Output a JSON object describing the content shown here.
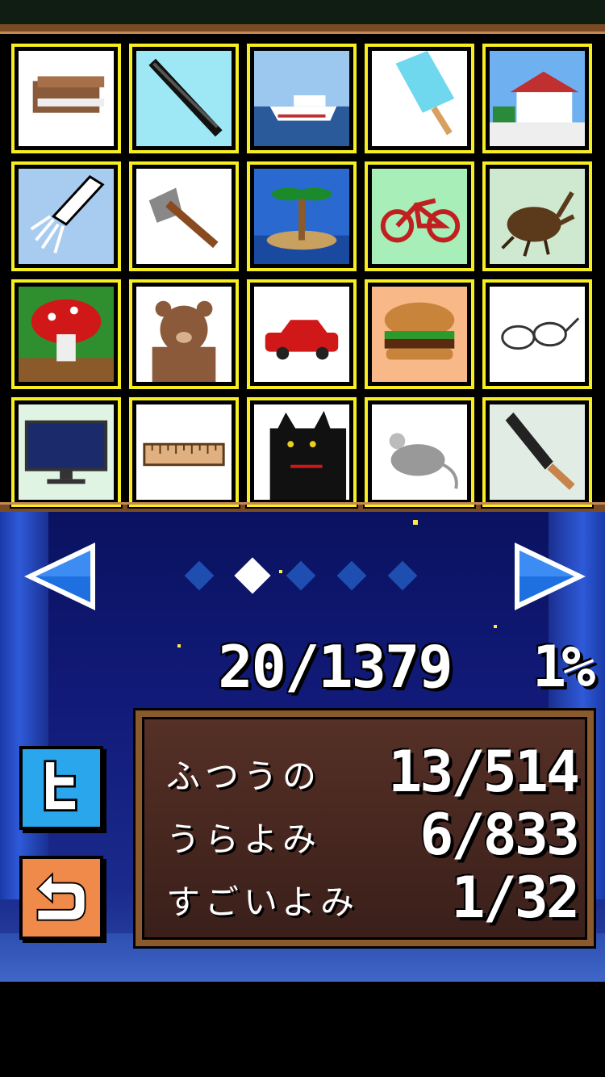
{
  "collection_grid": {
    "items": [
      {
        "name": "book-icon",
        "bg": "#ffffff"
      },
      {
        "name": "flute-icon",
        "bg": "#9ee8f5"
      },
      {
        "name": "ship-icon",
        "bg": "#9cc8f0"
      },
      {
        "name": "popsicle-icon",
        "bg": "#ffffff"
      },
      {
        "name": "house-icon",
        "bg": "#6fb0f0"
      },
      {
        "name": "squid-icon",
        "bg": "#a8ccf0"
      },
      {
        "name": "axe-icon",
        "bg": "#ffffff"
      },
      {
        "name": "island-icon",
        "bg": "#2a6ad0"
      },
      {
        "name": "bicycle-icon",
        "bg": "#a8eeb8"
      },
      {
        "name": "beetle-icon",
        "bg": "#cfe9d0"
      },
      {
        "name": "mushroom-cloud-icon",
        "bg": "#2f8f2f"
      },
      {
        "name": "bear-icon",
        "bg": "#ffffff"
      },
      {
        "name": "car-icon",
        "bg": "#ffffff"
      },
      {
        "name": "hamburger-icon",
        "bg": "#f8b888"
      },
      {
        "name": "glasses-icon",
        "bg": "#ffffff"
      },
      {
        "name": "monitor-icon",
        "bg": "#e0f4e4"
      },
      {
        "name": "ruler-icon",
        "bg": "#ffffff"
      },
      {
        "name": "black-cat-icon",
        "bg": "#ffffff"
      },
      {
        "name": "rat-icon",
        "bg": "#ffffff"
      },
      {
        "name": "knife-icon",
        "bg": "#e0ece4"
      }
    ]
  },
  "pager": {
    "page_count": 5,
    "current_page": 2
  },
  "progress": {
    "total": "20/1379",
    "percent": "1%"
  },
  "stats": {
    "rows": [
      {
        "label": "ふつうの",
        "value": "13/514"
      },
      {
        "label": "うらよみ",
        "value": "6/833"
      },
      {
        "label": "すごいよみ",
        "value": "1/32"
      }
    ]
  },
  "buttons": {
    "twitter_icon": "twitter-icon",
    "back_icon": "back-icon"
  },
  "colors": {
    "tile_border": "#f7ee22",
    "frame_wood": "#7a4a24",
    "arrow_blue": "#1e6fe0",
    "twitter_blue": "#29a6ec",
    "back_orange": "#f08a4a"
  }
}
